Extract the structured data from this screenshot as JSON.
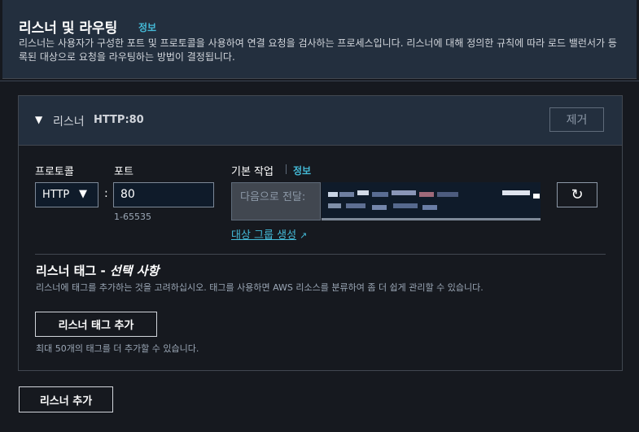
{
  "header": {
    "title": "리스너 및 라우팅",
    "info": "정보",
    "description": "리스너는 사용자가 구성한 포트 및 프로토콜을 사용하여 연결 요청을 검사하는 프로세스입니다. 리스너에 대해 정의한 규칙에 따라 로드 밸런서가 등록된 대상으로 요청을 라우팅하는 방법이 결정됩니다."
  },
  "listener": {
    "label": "리스너",
    "value": "HTTP:80",
    "remove_label": "제거",
    "protocol_label": "프로토콜",
    "protocol_value": "HTTP",
    "port_label": "포트",
    "port_value": "80",
    "port_range": "1-65535",
    "default_action_label": "기본 작업",
    "default_action_info": "정보",
    "action_placeholder": "다음으로 전달:",
    "create_target_group_link": "대상 그룹 생성"
  },
  "tags": {
    "title": "리스너 태그 -",
    "title_optional": "선택 사항",
    "description": "리스너에 태그를 추가하는 것을 고려하십시오. 태그를 사용하면 AWS 리소스를 분류하여 좀 더 쉽게 관리할 수 있습니다.",
    "add_button": "리스너 태그 추가",
    "note": "최대 50개의 태그를 더 추가할 수 있습니다."
  },
  "footer": {
    "add_listener_button": "리스너 추가"
  },
  "icons": {
    "caret": "caret-down-icon",
    "dropdown": "dropdown-arrow-icon",
    "refresh": "refresh-icon",
    "external": "external-link-icon"
  }
}
